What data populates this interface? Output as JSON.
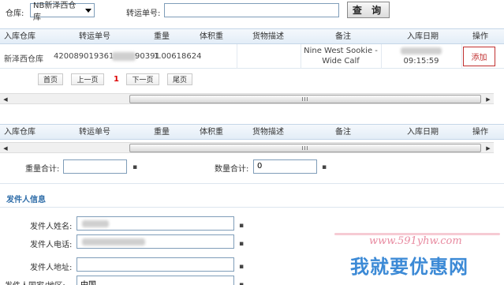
{
  "search": {
    "warehouse_label": "仓库:",
    "warehouse_value": "NB新泽西仓库",
    "tracking_label": "转运单号:",
    "tracking_value": "",
    "query_button": "查 询"
  },
  "table1": {
    "headers": [
      "入库仓库",
      "转运单号",
      "重量",
      "体积重",
      "货物描述",
      "备注",
      "入库日期",
      "操作"
    ],
    "rows": [
      {
        "warehouse": "新泽西仓库",
        "tracking": "420089019361",
        "tracking_tail": "90391",
        "weight_overlap": "1.00618624",
        "volume_weight": "",
        "description": "",
        "remark_line1": "Nine West Sookie -",
        "remark_line2": "Wide Calf",
        "date_time": "09:15:59",
        "action": "添加"
      }
    ]
  },
  "pager": {
    "first": "首页",
    "prev": "上一页",
    "current": "1",
    "next": "下一页",
    "last": "尾页"
  },
  "scrollbar": {
    "thumb_grip": "III"
  },
  "table2": {
    "headers": [
      "入库仓库",
      "转运单号",
      "重量",
      "体积重",
      "货物描述",
      "备注",
      "入库日期",
      "操作"
    ]
  },
  "totals": {
    "weight_label": "重量合计:",
    "weight_value": "",
    "qty_label": "数量合计:",
    "qty_value": "0"
  },
  "sender": {
    "section_title": "发件人信息",
    "name_label": "发件人姓名:",
    "phone_label": "发件人电话:",
    "address_label": "发件人地址:",
    "address_value": "",
    "country_label": "发件人国家/地区:",
    "country_value": "中国"
  },
  "watermark": {
    "url": "www.591yhw.com",
    "site_name": "我就要优惠网"
  },
  "colors": {
    "header_bg": "#e3edf7",
    "add_button": "#c03030",
    "section_title": "#2d6ca8",
    "watermark_blue": "#3c8ad6",
    "watermark_pink": "#e88aa0"
  }
}
